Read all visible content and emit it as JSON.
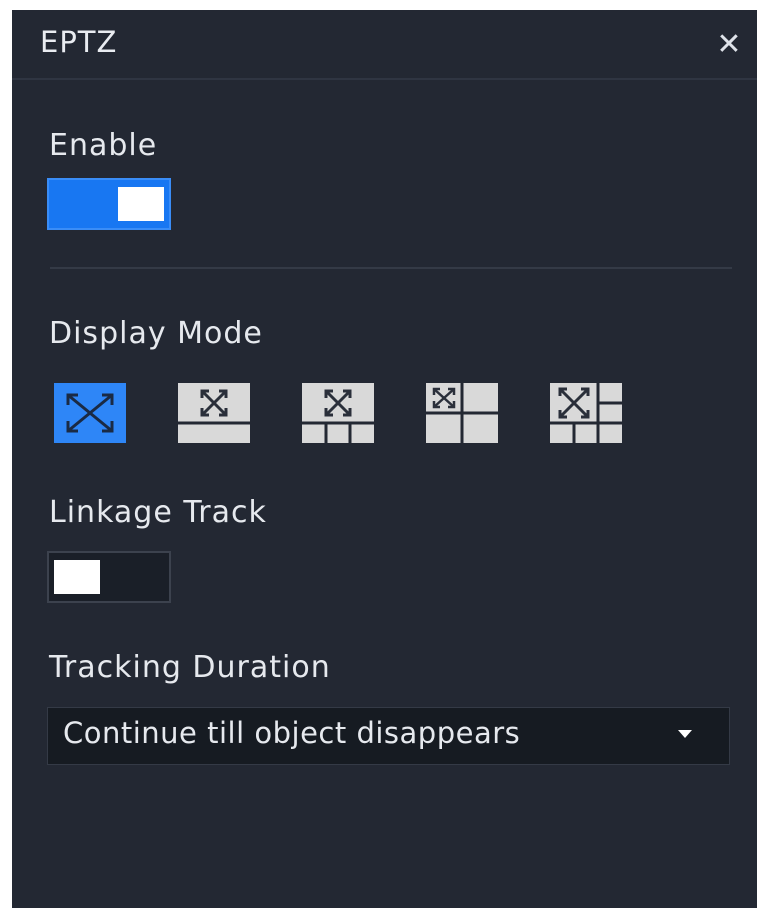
{
  "dialog": {
    "title": "EPTZ",
    "close_icon": "close-icon"
  },
  "enable": {
    "label": "Enable",
    "state": true,
    "on_color": "#1877f2"
  },
  "display_mode": {
    "label": "Display Mode",
    "selected_index": 0,
    "options": [
      {
        "icon": "fullscreen-mode-icon"
      },
      {
        "icon": "main-plus-bottom-strip-icon"
      },
      {
        "icon": "main-plus-three-bottom-icon"
      },
      {
        "icon": "quad-split-icon"
      },
      {
        "icon": "main-plus-side-and-bottom-icon"
      }
    ]
  },
  "linkage_track": {
    "label": "Linkage Track",
    "state": false
  },
  "tracking_duration": {
    "label": "Tracking Duration",
    "value": "Continue till object disappears"
  }
}
